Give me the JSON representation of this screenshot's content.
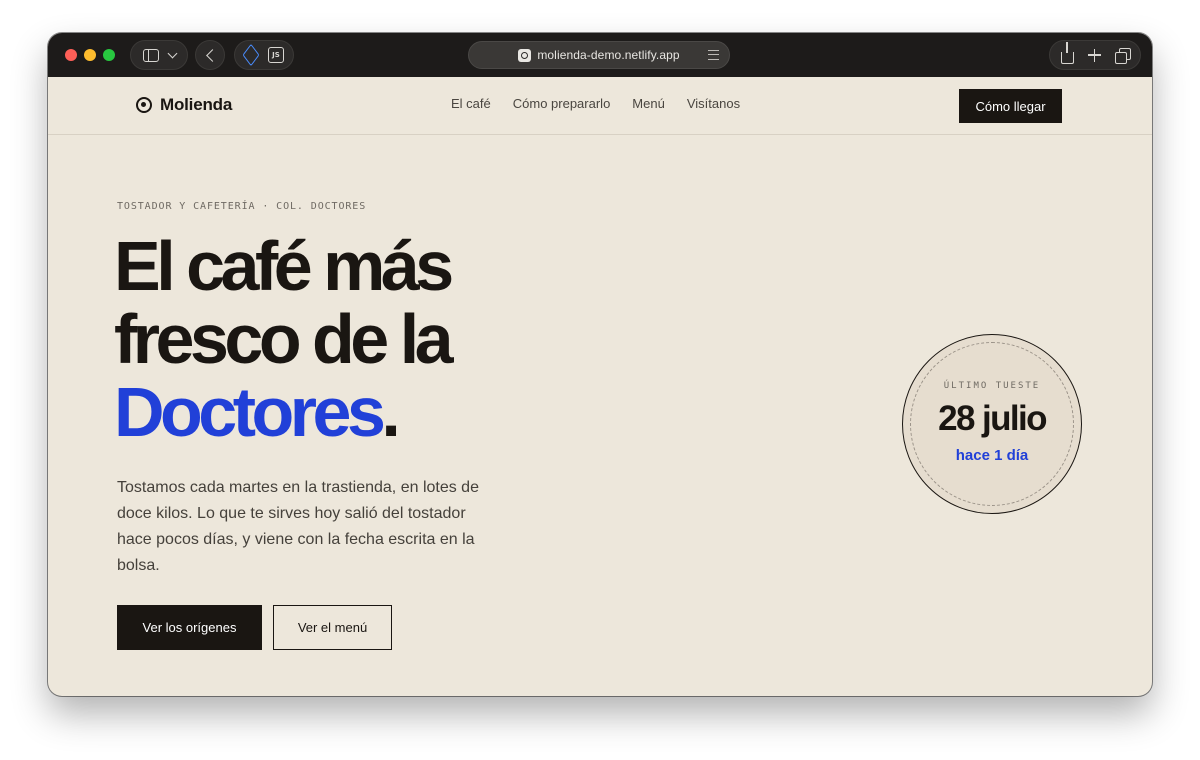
{
  "browser": {
    "url": "molienda-demo.netlify.app",
    "extension_label": "JS"
  },
  "site": {
    "brand": "Molienda",
    "nav": [
      {
        "label": "El café"
      },
      {
        "label": "Cómo prepararlo"
      },
      {
        "label": "Menú"
      },
      {
        "label": "Visítanos"
      }
    ],
    "cta": "Cómo llegar"
  },
  "hero": {
    "eyebrow": "TOSTADOR Y CAFETERÍA · COL. DOCTORES",
    "headline_line1": "El café más",
    "headline_line2": "fresco de la",
    "headline_accent": "Doctores",
    "headline_period": ".",
    "lead": "Tostamos cada martes en la trastienda, en lotes de doce kilos. Lo que te sirves hoy salió del tostador hace pocos días, y viene con la fecha escrita en la bolsa.",
    "primary_button": "Ver los orígenes",
    "secondary_button": "Ver el menú"
  },
  "roast_badge": {
    "label": "ÚLTIMO TUESTE",
    "date": "28 julio",
    "ago": "hace 1 día"
  },
  "colors": {
    "page_background": "#ede7db",
    "ink": "#1a1612",
    "accent_blue": "#2140d8",
    "badge_fill": "#e6ddcf",
    "browser_chrome": "#1d1b1a"
  },
  "icons": [
    "sidebar-icon",
    "chevron-down-icon",
    "back-icon",
    "cube-extension-icon",
    "js-extension-icon",
    "site-favicon-icon",
    "reader-icon",
    "share-icon",
    "new-tab-icon",
    "tabs-overview-icon",
    "logo-icon"
  ]
}
